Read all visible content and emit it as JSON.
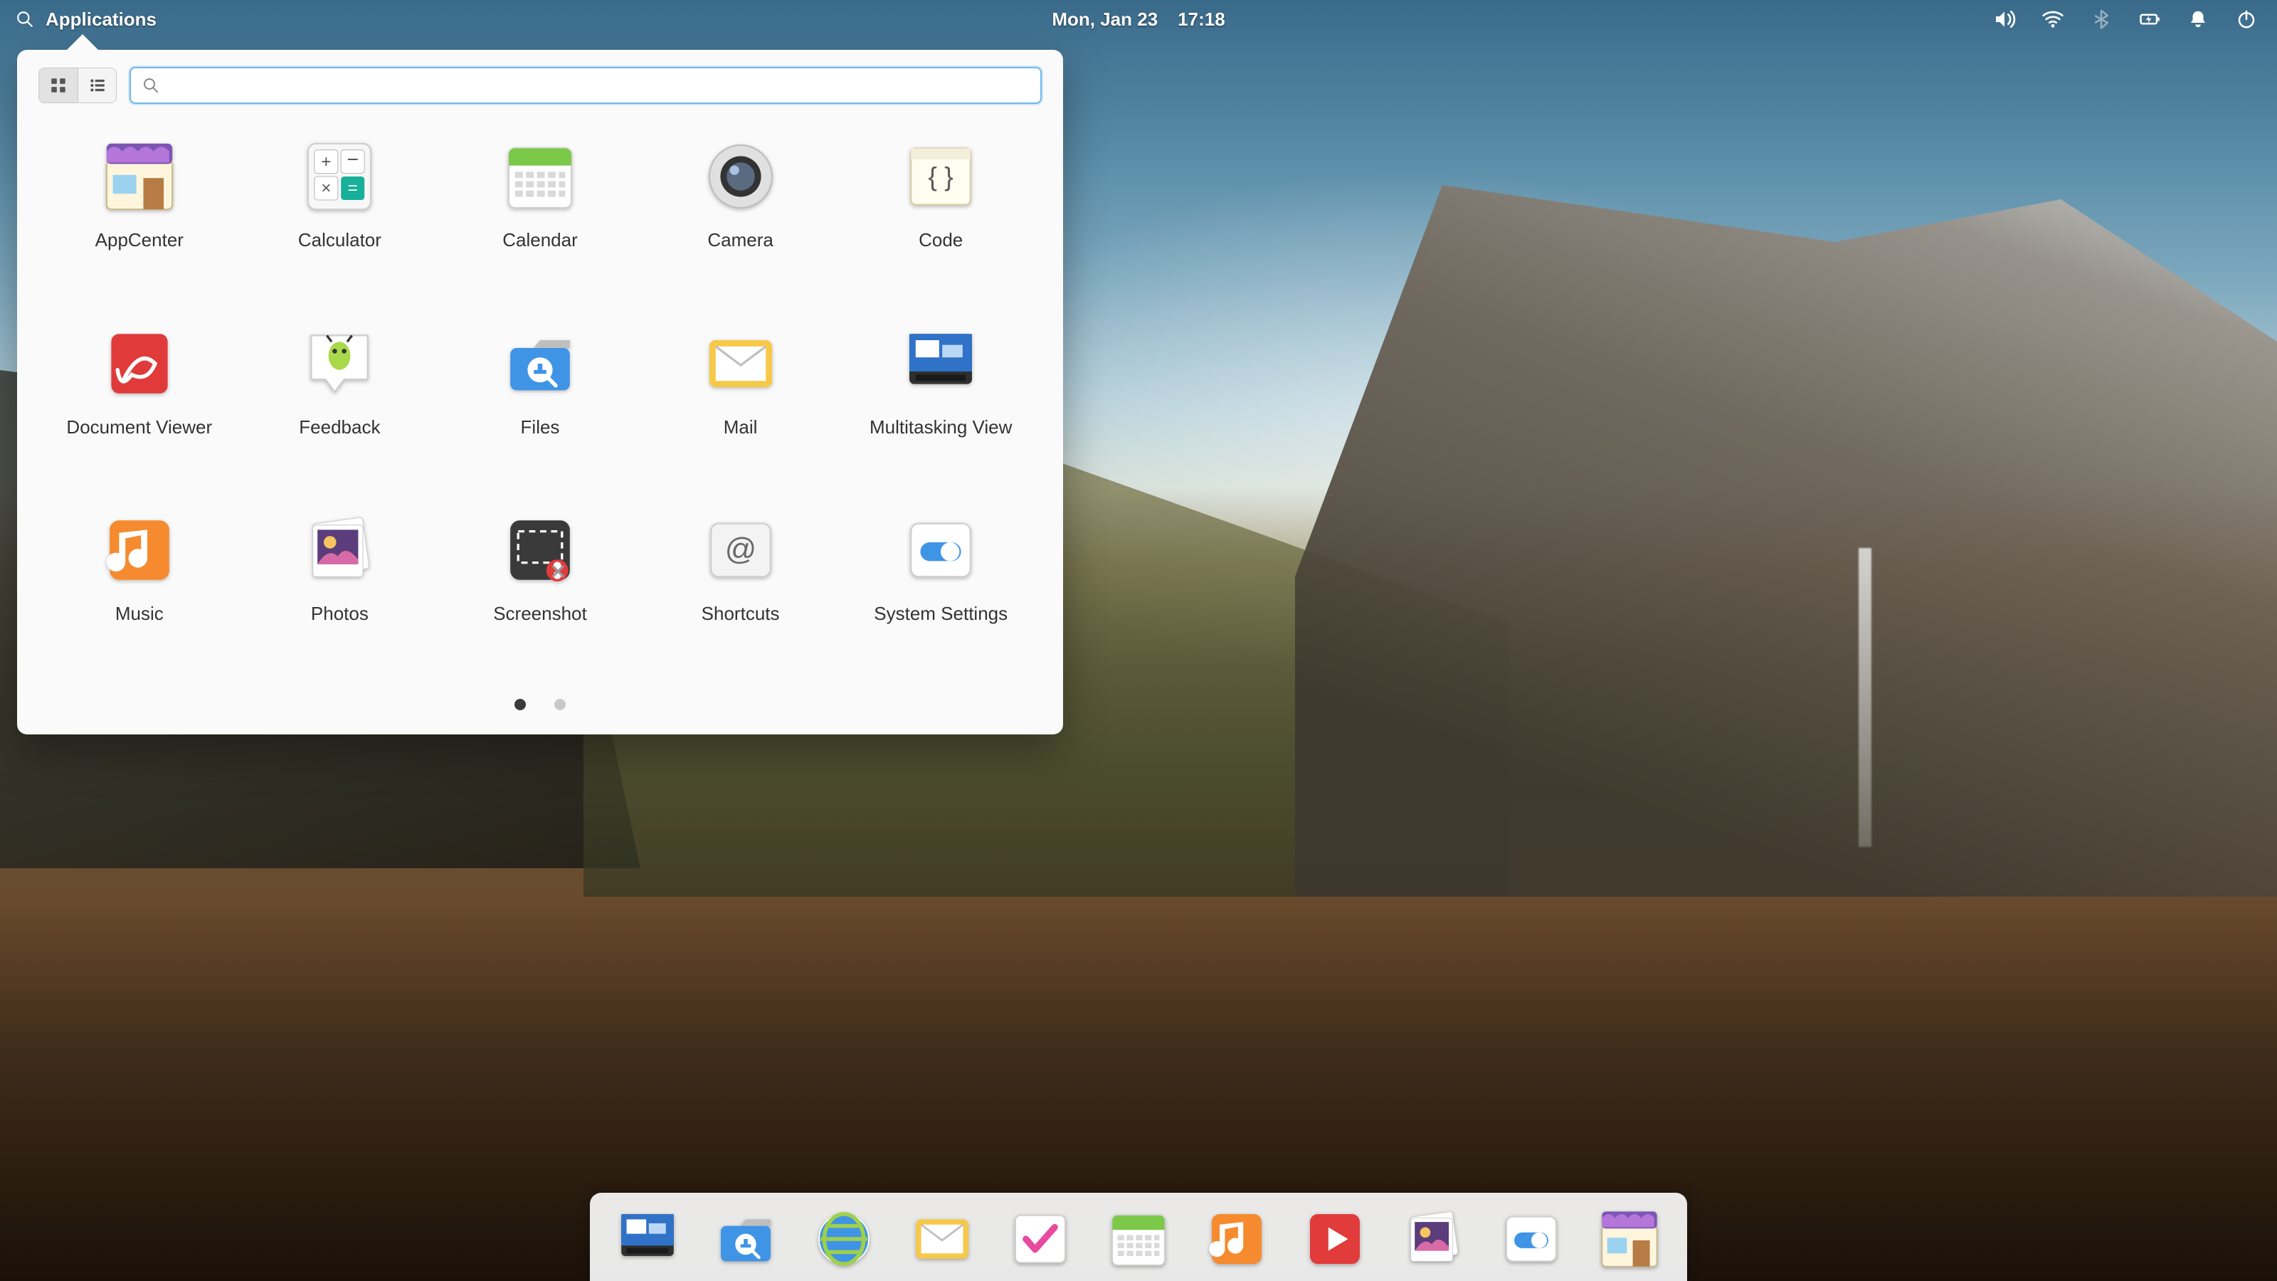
{
  "panel": {
    "applications_label": "Applications",
    "date": "Mon, Jan 23",
    "time": "17:18",
    "tray": [
      "volume-icon",
      "wifi-icon",
      "bluetooth-off-icon",
      "battery-charging-icon",
      "notifications-icon",
      "power-icon"
    ]
  },
  "launcher": {
    "search_placeholder": "",
    "view_mode": "grid",
    "pages": {
      "count": 2,
      "active": 1
    },
    "apps": [
      {
        "id": "appcenter",
        "label": "AppCenter"
      },
      {
        "id": "calculator",
        "label": "Calculator"
      },
      {
        "id": "calendar",
        "label": "Calendar"
      },
      {
        "id": "camera",
        "label": "Camera"
      },
      {
        "id": "code",
        "label": "Code"
      },
      {
        "id": "document-viewer",
        "label": "Document Viewer"
      },
      {
        "id": "feedback",
        "label": "Feedback"
      },
      {
        "id": "files",
        "label": "Files"
      },
      {
        "id": "mail",
        "label": "Mail"
      },
      {
        "id": "multitasking-view",
        "label": "Multitasking View"
      },
      {
        "id": "music",
        "label": "Music"
      },
      {
        "id": "photos",
        "label": "Photos"
      },
      {
        "id": "screenshot",
        "label": "Screenshot"
      },
      {
        "id": "shortcuts",
        "label": "Shortcuts"
      },
      {
        "id": "system-settings",
        "label": "System Settings"
      }
    ]
  },
  "dock": {
    "items": [
      {
        "id": "multitasking-view",
        "name": "Multitasking View"
      },
      {
        "id": "files",
        "name": "Files"
      },
      {
        "id": "web",
        "name": "Web"
      },
      {
        "id": "mail",
        "name": "Mail"
      },
      {
        "id": "tasks",
        "name": "Tasks"
      },
      {
        "id": "calendar",
        "name": "Calendar"
      },
      {
        "id": "music",
        "name": "Music"
      },
      {
        "id": "videos",
        "name": "Videos"
      },
      {
        "id": "photos",
        "name": "Photos"
      },
      {
        "id": "system-settings",
        "name": "System Settings"
      },
      {
        "id": "appcenter",
        "name": "AppCenter"
      }
    ]
  }
}
